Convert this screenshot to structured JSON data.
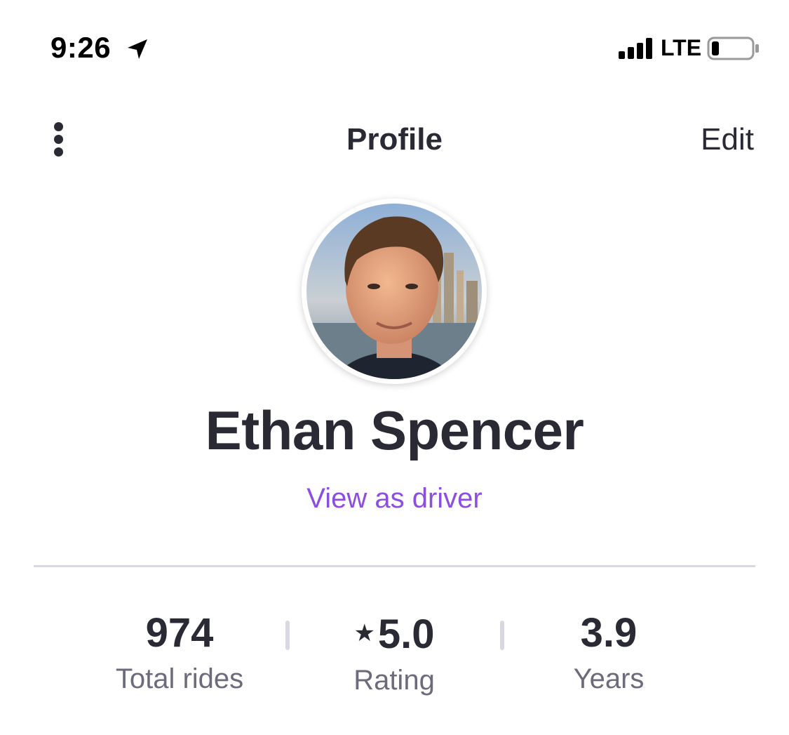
{
  "status_bar": {
    "time": "9:26",
    "network": "LTE",
    "icons": [
      "location-arrow-icon",
      "cellular-signal-icon",
      "battery-icon"
    ]
  },
  "nav": {
    "title": "Profile",
    "edit_label": "Edit",
    "menu_icon": "vertical-ellipsis-icon"
  },
  "profile": {
    "name": "Ethan Spencer",
    "view_as_driver": "View as driver"
  },
  "stats": [
    {
      "value": "974",
      "label": "Total rides"
    },
    {
      "value": "5.0",
      "label": "Rating",
      "icon": "star-icon",
      "icon_glyph": "★"
    },
    {
      "value": "3.9",
      "label": "Years"
    }
  ],
  "colors": {
    "text": "#2a2a35",
    "accent": "#8b4ee0",
    "muted": "#6c6b7b",
    "divider": "#d9d8e2"
  }
}
